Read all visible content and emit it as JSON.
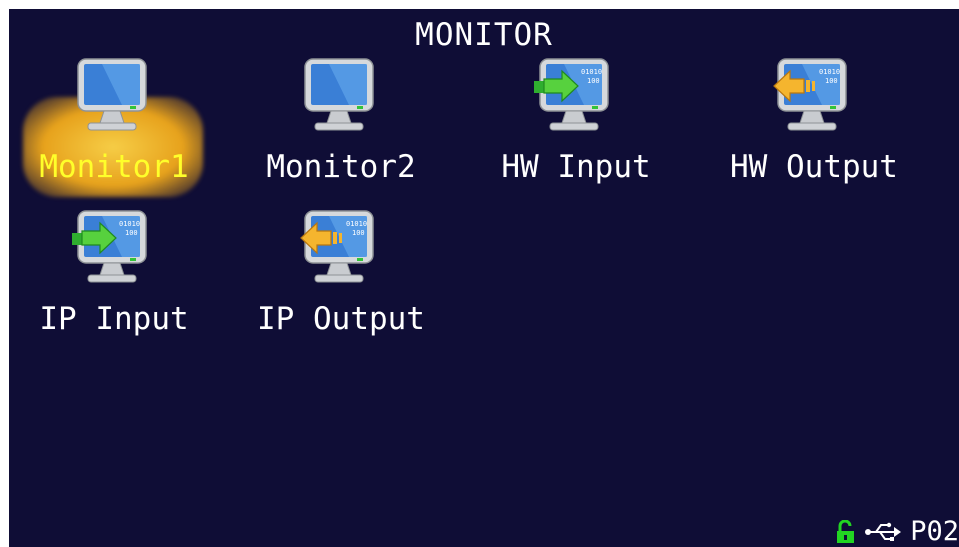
{
  "screen": {
    "title": "MONITOR",
    "selected_item": "Monitor1",
    "items": [
      {
        "label": "Monitor1",
        "icon": "monitor-icon"
      },
      {
        "label": "Monitor2",
        "icon": "monitor-icon"
      },
      {
        "label": "HW Input",
        "icon": "monitor-input-icon"
      },
      {
        "label": "HW Output",
        "icon": "monitor-output-icon"
      },
      {
        "label": "IP Input",
        "icon": "monitor-input-icon"
      },
      {
        "label": "IP Output",
        "icon": "monitor-output-icon"
      }
    ]
  },
  "status_bar": {
    "lock_icon": "unlock-icon",
    "usb_icon": "usb-icon",
    "page": "P02"
  },
  "colors": {
    "background": "#0f0d36",
    "selected_label": "#ffff2a",
    "highlight": "#e7a21c",
    "lock": "#22d422"
  }
}
